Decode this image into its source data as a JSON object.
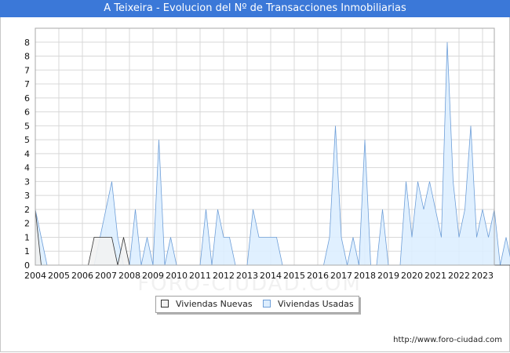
{
  "title": "A Teixeira - Evolucion del Nº de Transacciones Inmobiliarias",
  "watermark": "FORO-CIUDAD.COM",
  "footer_url": "http://www.foro-ciudad.com",
  "colors": {
    "title_bg": "#3b78d8",
    "nuevas_fill": "#f2f2f2",
    "nuevas_line": "#333333",
    "usadas_fill": "#ddeeff",
    "usadas_line": "#6f9fd8",
    "grid": "#d8d8d8"
  },
  "chart_data": {
    "type": "area",
    "title": "A Teixeira - Evolucion del Nº de Transacciones Inmobiliarias",
    "x_ticks": [
      "2004",
      "2005",
      "2006",
      "2007",
      "2008",
      "2009",
      "2010",
      "2011",
      "2012",
      "2013",
      "2014",
      "2015",
      "2016",
      "2017",
      "2018",
      "2019",
      "2020",
      "2021",
      "2022",
      "2023"
    ],
    "y_ticks": [
      "0",
      "1",
      "1",
      "2",
      "2",
      "3",
      "3",
      "4",
      "4",
      "5",
      "5",
      "6",
      "6",
      "7",
      "7",
      "8",
      "8"
    ],
    "ylim": [
      0,
      8.5
    ],
    "grid": true,
    "legend_position": "bottom",
    "x_start": 2004.0,
    "x_step": 0.25,
    "series": [
      {
        "name": "Viviendas Nuevas",
        "values": [
          2,
          0,
          0,
          0,
          0,
          0,
          0,
          0,
          0,
          0,
          1,
          1,
          1,
          1,
          0,
          1,
          0,
          0,
          0,
          0,
          0,
          0,
          0,
          0,
          0,
          0,
          0,
          0,
          0,
          0,
          0,
          0,
          0,
          0,
          0,
          0,
          0,
          0,
          0,
          0,
          0,
          0,
          0,
          0,
          0,
          0,
          0,
          0,
          0,
          0,
          0,
          0,
          0,
          0,
          0,
          0,
          0,
          0,
          0,
          0,
          0,
          0,
          0,
          0,
          0,
          0,
          0,
          0,
          0,
          0,
          0,
          0,
          0,
          0,
          0,
          0,
          0,
          0,
          0,
          0,
          0,
          0,
          0,
          0,
          0,
          0,
          0,
          0
        ]
      },
      {
        "name": "Viviendas Usadas",
        "values": [
          2,
          1,
          0,
          0,
          0,
          0,
          0,
          0,
          0,
          0,
          0,
          1,
          2,
          3,
          1,
          0,
          0,
          2,
          0,
          1,
          0,
          4.5,
          0,
          1,
          0,
          0,
          0,
          0,
          0,
          2,
          0,
          2,
          1,
          1,
          0,
          0,
          0,
          2,
          1,
          1,
          1,
          1,
          0,
          0,
          0,
          0,
          0,
          0,
          0,
          0,
          1,
          5,
          1,
          0,
          1,
          0,
          4.5,
          0,
          0,
          2,
          0,
          0,
          0,
          3,
          1,
          3,
          2,
          3,
          2,
          1,
          8,
          3,
          1,
          2,
          5,
          1,
          2,
          1,
          2,
          0,
          1,
          0
        ]
      }
    ]
  },
  "legend": {
    "nuevas_label": "Viviendas Nuevas",
    "usadas_label": "Viviendas Usadas"
  }
}
